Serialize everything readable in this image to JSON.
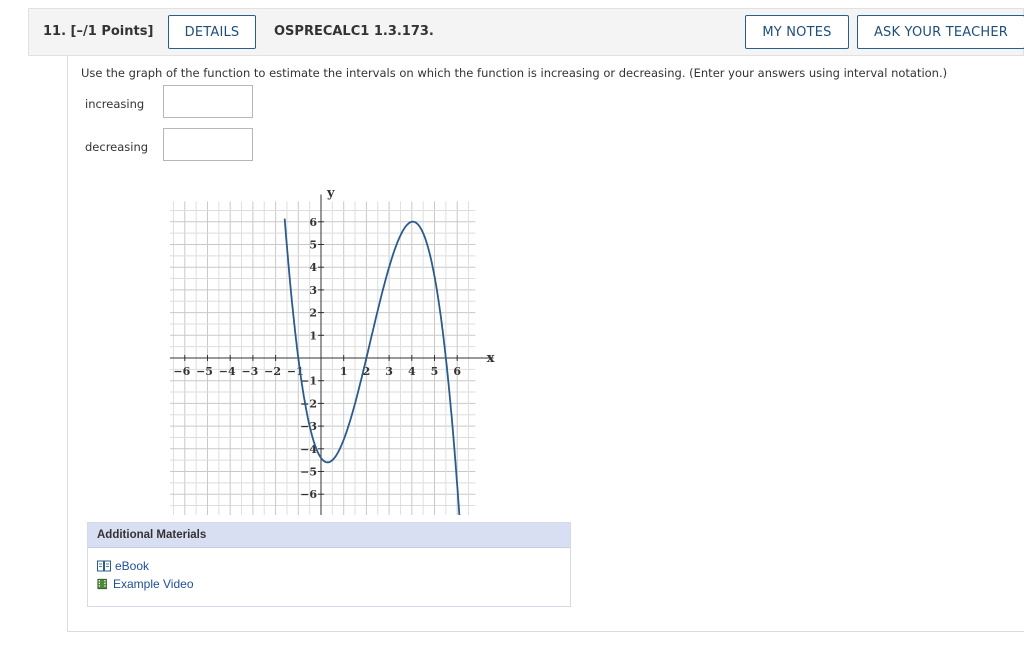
{
  "header": {
    "question_number": "11. [–/1 Points]",
    "details_label": "DETAILS",
    "code": "OSPRECALC1 1.3.173.",
    "my_notes_label": "MY NOTES",
    "ask_teacher_label": "ASK YOUR TEACHER"
  },
  "question": {
    "instructions": "Use the graph of the function to estimate the intervals on which the function is increasing or decreasing. (Enter your answers using interval notation.)",
    "fields": [
      {
        "label": "increasing",
        "value": ""
      },
      {
        "label": "decreasing",
        "value": ""
      }
    ]
  },
  "graph": {
    "x_axis_label": "x",
    "y_axis_label": "y",
    "x_ticks": [
      "−6",
      "−5",
      "−4",
      "−3",
      "−2",
      "−1",
      "1",
      "2",
      "3",
      "4",
      "5",
      "6"
    ],
    "y_ticks": [
      "6",
      "5",
      "4",
      "3",
      "2",
      "1",
      "−1",
      "−2",
      "−3",
      "−4",
      "−5",
      "−6"
    ],
    "curve_color": "#2b5b8c"
  },
  "materials": {
    "heading": "Additional Materials",
    "links": [
      {
        "label": "eBook",
        "icon": "book-icon"
      },
      {
        "label": "Example Video",
        "icon": "film-icon"
      }
    ]
  }
}
